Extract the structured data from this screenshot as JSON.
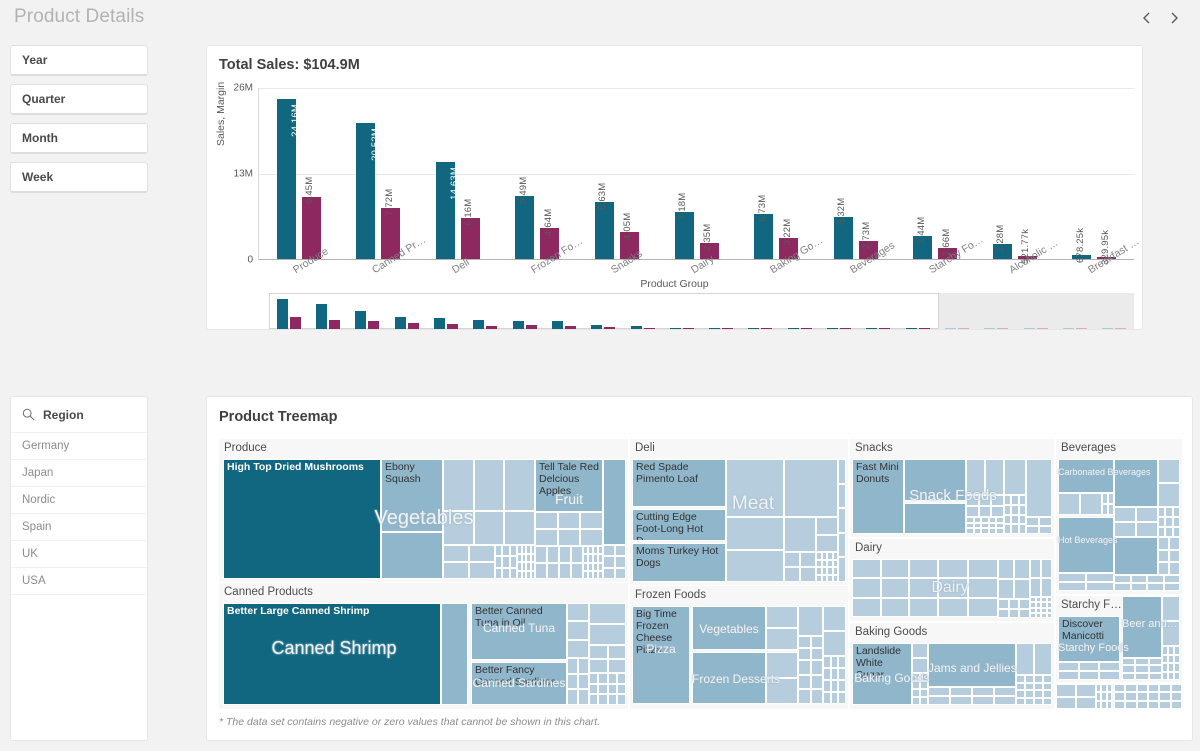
{
  "header": {
    "title": "Product Details",
    "prev_label": "‹",
    "next_label": "›"
  },
  "filters": {
    "buttons": [
      {
        "label": "Year"
      },
      {
        "label": "Quarter"
      },
      {
        "label": "Month"
      },
      {
        "label": "Week"
      }
    ]
  },
  "region_listbox": {
    "title": "Region",
    "items": [
      "Germany",
      "Japan",
      "Nordic",
      "Spain",
      "UK",
      "USA"
    ]
  },
  "barchart": {
    "title": "Total Sales: $104.9M",
    "xaxis_title": "Product Group",
    "yaxis_title": "Sales, Margin"
  },
  "treemap": {
    "title": "Product Treemap",
    "note": "* The data set contains negative or zero values that cannot be shown in this chart.",
    "groups": [
      {
        "label": "Produce"
      },
      {
        "label": "Canned Products"
      },
      {
        "label": "Deli"
      },
      {
        "label": "Frozen Foods"
      },
      {
        "label": "Snacks"
      },
      {
        "label": "Dairy"
      },
      {
        "label": "Baking Goods"
      },
      {
        "label": "Beverages"
      },
      {
        "label": "Starchy F…"
      }
    ],
    "leaves": [
      {
        "label": "High Top Dried Mushrooms"
      },
      {
        "label": "Ebony Squash"
      },
      {
        "label": "Tell Tale Red Delcious Apples"
      },
      {
        "label": "Better Large Canned Shrimp"
      },
      {
        "label": "Better Canned Tuna in Oil"
      },
      {
        "label": "Better Fancy Canned Sardines"
      },
      {
        "label": "Red Spade Pimento Loaf"
      },
      {
        "label": "Cutting Edge Foot-Long Hot D…"
      },
      {
        "label": "Moms Turkey Hot Dogs"
      },
      {
        "label": "Big Time Frozen Cheese Pizza"
      },
      {
        "label": "Fast Mini Donuts"
      },
      {
        "label": "Landslide White Sugar"
      },
      {
        "label": "Discover Manicotti"
      }
    ],
    "category_labels": [
      {
        "label": "Vegetables"
      },
      {
        "label": "Fruit"
      },
      {
        "label": "Canned Shrimp"
      },
      {
        "label": "Canned Tuna"
      },
      {
        "label": "Canned Sardines"
      },
      {
        "label": "Meat"
      },
      {
        "label": "Vegetables"
      },
      {
        "label": "Frozen Desserts"
      },
      {
        "label": "Pizza"
      },
      {
        "label": "Snack Foods"
      },
      {
        "label": "Dairy"
      },
      {
        "label": "Baking Goods"
      },
      {
        "label": "Jams and Jellies"
      },
      {
        "label": "Carbonated Beverages"
      },
      {
        "label": "Hot Beverages"
      },
      {
        "label": "Starchy Foods"
      },
      {
        "label": "Beer and…"
      }
    ]
  },
  "colors": {
    "sales": "#10677f",
    "margin": "#8e2860",
    "treemap_dark": "#10677f",
    "treemap_mid": "#8fb6ca",
    "treemap_light": "#b6cddd",
    "background": "#f2f2f2"
  },
  "chart_data": {
    "type": "bar",
    "title": "Total Sales: $104.9M",
    "xlabel": "Product Group",
    "ylabel": "Sales, Margin",
    "ylim": [
      0,
      26000000
    ],
    "yticks": [
      "0",
      "13M",
      "26M"
    ],
    "grid": true,
    "legend": "none",
    "categories": [
      "Produce",
      "Canned Pr…",
      "Deli",
      "Frozen Fo…",
      "Snacks",
      "Dairy",
      "Baking Go…",
      "Beverages",
      "Starchy Fo…",
      "Alcoholic …",
      "Breakfast …"
    ],
    "series": [
      {
        "name": "Sales",
        "color": "#10677f",
        "values": [
          24160000,
          20520000,
          14630000,
          9490000,
          8630000,
          7180000,
          6730000,
          6320000,
          3440000,
          2280000,
          678250
        ],
        "labels": [
          "24.16M",
          "20.52M",
          "14.63M",
          "9.49M",
          "8.63M",
          "7.18M",
          "6.73M",
          "6.32M",
          "3.44M",
          "2.28M",
          "678.25k"
        ]
      },
      {
        "name": "Margin",
        "color": "#8e2860",
        "values": [
          9450000,
          7720000,
          6160000,
          4640000,
          4050000,
          2350000,
          3220000,
          2730000,
          1660000,
          521770,
          329950
        ],
        "labels": [
          "9.45M",
          "7.72M",
          "6.16M",
          "4.64M",
          "4.05M",
          "2.35M",
          "3.22M",
          "2.73M",
          "1.66M",
          "521.77k",
          "329.95k"
        ]
      }
    ]
  }
}
